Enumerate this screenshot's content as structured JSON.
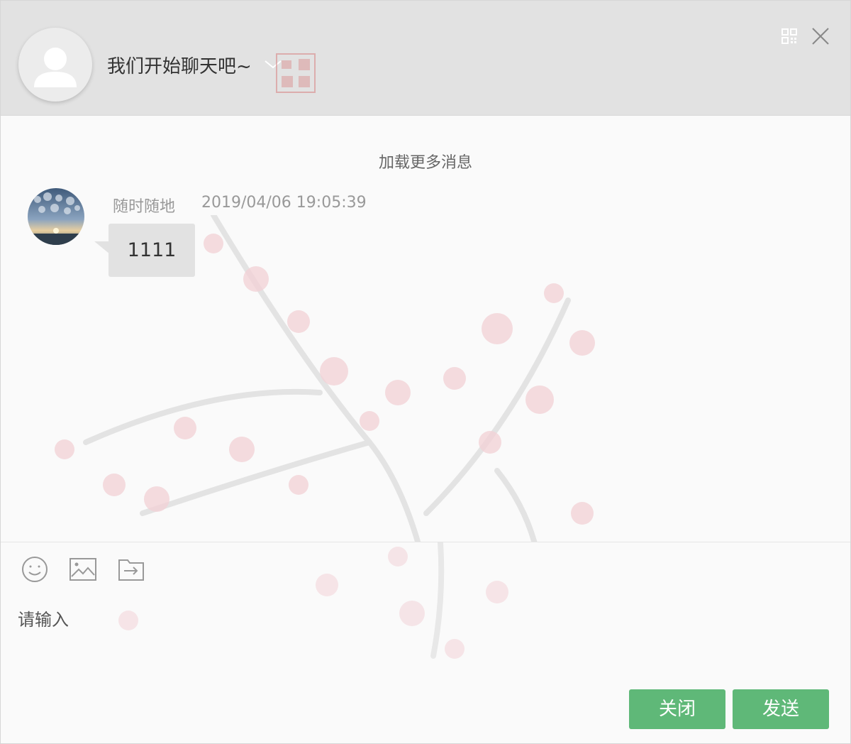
{
  "header": {
    "title": "我们开始聊天吧~",
    "qr_icon": "qrcode-icon",
    "close_icon": "close-icon",
    "avatar_icon": "default-user-icon"
  },
  "chat": {
    "load_more": "加载更多消息",
    "messages": [
      {
        "user": "随时随地",
        "time": "2019/04/06 19:05:39",
        "text": "1111"
      }
    ]
  },
  "toolbar": {
    "icons": [
      "emoji-icon",
      "image-icon",
      "file-icon"
    ]
  },
  "composer": {
    "placeholder": "请输入"
  },
  "buttons": {
    "close": "关闭",
    "send": "发送"
  },
  "colors": {
    "accent": "#5fb878",
    "header_bg": "#e2e2e2",
    "bubble_bg": "#e2e2e2"
  }
}
